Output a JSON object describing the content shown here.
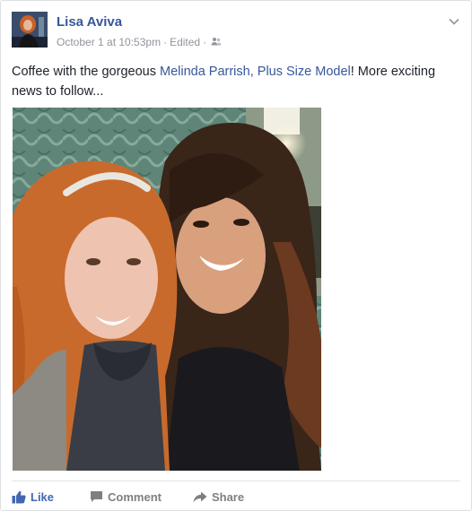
{
  "post": {
    "author": "Lisa Aviva",
    "timestamp": "October 1 at 10:53pm",
    "separator": "·",
    "edited_label": "Edited",
    "audience_icon": "friends-icon",
    "text_before": "Coffee with the gorgeous ",
    "tagged_link": "Melinda Parrish, Plus Size Model",
    "text_after": "! More exciting news to follow..."
  },
  "actions": {
    "like_label": "Like",
    "comment_label": "Comment",
    "share_label": "Share"
  },
  "colors": {
    "link": "#365899",
    "like_blue": "#4267b2",
    "meta_gray": "#90949c"
  }
}
